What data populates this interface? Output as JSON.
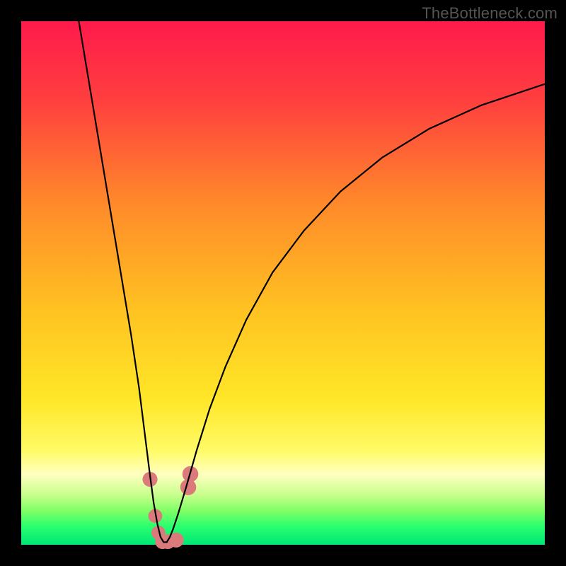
{
  "watermark": "TheBottleneck.com",
  "chart_data": {
    "type": "line",
    "title": "",
    "xlabel": "",
    "ylabel": "",
    "xlim": [
      0,
      100
    ],
    "ylim": [
      0,
      100
    ],
    "grid": false,
    "legend": false,
    "gradient_stops": [
      {
        "offset": 0.0,
        "color": "#ff1a4b"
      },
      {
        "offset": 0.15,
        "color": "#ff3f3f"
      },
      {
        "offset": 0.35,
        "color": "#ff8a2a"
      },
      {
        "offset": 0.55,
        "color": "#ffc222"
      },
      {
        "offset": 0.72,
        "color": "#ffe627"
      },
      {
        "offset": 0.82,
        "color": "#fffb66"
      },
      {
        "offset": 0.865,
        "color": "#ffffc0"
      },
      {
        "offset": 0.905,
        "color": "#c7ff8c"
      },
      {
        "offset": 0.935,
        "color": "#7fff66"
      },
      {
        "offset": 0.965,
        "color": "#2aff6e"
      },
      {
        "offset": 1.0,
        "color": "#00e676"
      }
    ],
    "series": [
      {
        "name": "bottleneck-curve",
        "color": "#000000",
        "x": [
          11,
          13,
          15,
          17,
          19,
          21,
          22.5,
          23.5,
          24.5,
          25.3,
          26,
          26.6,
          27.2,
          27.8,
          28.4,
          29,
          30,
          31.5,
          33.5,
          36,
          39,
          43,
          48,
          54,
          61,
          69,
          78,
          88,
          100
        ],
        "y": [
          100,
          88,
          76,
          64,
          52,
          40,
          30,
          22,
          14,
          8,
          4,
          1.5,
          0.5,
          0.5,
          1.5,
          3,
          6,
          11,
          18,
          26,
          34,
          43,
          52,
          60,
          67.5,
          74,
          79.5,
          84,
          88
        ]
      }
    ],
    "markers": {
      "name": "data-points",
      "color": "#db7a7a",
      "points": [
        {
          "x": 24.6,
          "y": 12.5,
          "r": 1.5
        },
        {
          "x": 25.6,
          "y": 5.5,
          "r": 1.4
        },
        {
          "x": 26.2,
          "y": 2.3,
          "r": 1.4
        },
        {
          "x": 27.0,
          "y": 0.6,
          "r": 1.5
        },
        {
          "x": 28.0,
          "y": 0.6,
          "r": 1.5
        },
        {
          "x": 29.6,
          "y": 0.9,
          "r": 1.5
        },
        {
          "x": 31.9,
          "y": 11.0,
          "r": 1.6
        },
        {
          "x": 32.3,
          "y": 13.5,
          "r": 1.6
        }
      ]
    }
  }
}
